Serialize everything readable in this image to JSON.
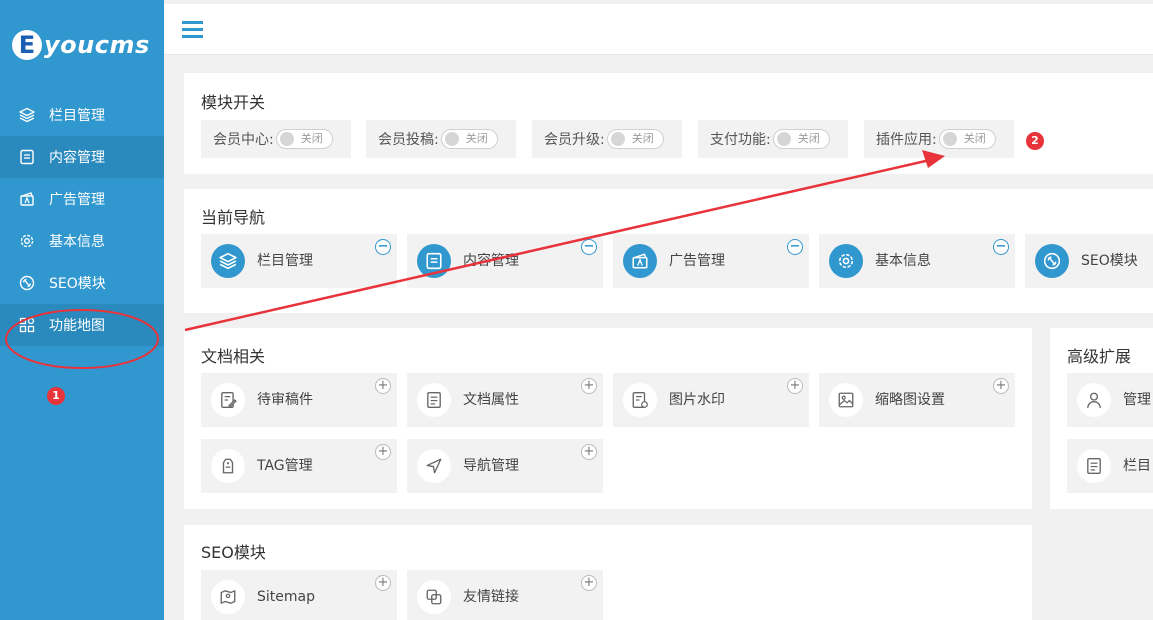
{
  "app": {
    "logo_letter": "E",
    "logo_text": "youcms"
  },
  "sidebar": {
    "items": [
      {
        "label": "栏目管理",
        "icon": "layers-icon"
      },
      {
        "label": "内容管理",
        "icon": "document-icon"
      },
      {
        "label": "广告管理",
        "icon": "ad-icon"
      },
      {
        "label": "基本信息",
        "icon": "gear-icon"
      },
      {
        "label": "SEO模块",
        "icon": "seo-icon"
      },
      {
        "label": "功能地图",
        "icon": "grid-icon"
      }
    ],
    "annotation_badge": "1"
  },
  "module_switch": {
    "title": "模块开关",
    "items": [
      {
        "label": "会员中心:",
        "state": "关闭"
      },
      {
        "label": "会员投稿:",
        "state": "关闭"
      },
      {
        "label": "会员升级:",
        "state": "关闭"
      },
      {
        "label": "支付功能:",
        "state": "关闭"
      },
      {
        "label": "插件应用:",
        "state": "关闭"
      }
    ],
    "annotation_badge": "2"
  },
  "current_nav": {
    "title": "当前导航",
    "items": [
      {
        "label": "栏目管理",
        "icon": "layers-icon"
      },
      {
        "label": "内容管理",
        "icon": "document-icon"
      },
      {
        "label": "广告管理",
        "icon": "ad-icon"
      },
      {
        "label": "基本信息",
        "icon": "gear-icon"
      },
      {
        "label": "SEO模块",
        "icon": "seo-icon"
      }
    ],
    "corner_symbol": "−"
  },
  "docs": {
    "title": "文档相关",
    "items": [
      {
        "label": "待审稿件",
        "icon": "pending-edit-icon"
      },
      {
        "label": "文档属性",
        "icon": "document-icon"
      },
      {
        "label": "图片水印",
        "icon": "watermark-icon"
      },
      {
        "label": "缩略图设置",
        "icon": "image-icon"
      },
      {
        "label": "TAG管理",
        "icon": "tag-icon"
      },
      {
        "label": "导航管理",
        "icon": "navigation-icon"
      }
    ],
    "corner_symbol": "+"
  },
  "advanced": {
    "title": "高级扩展",
    "items": [
      {
        "label": "管理",
        "icon": "user-icon"
      },
      {
        "label": "栏目",
        "icon": "document-icon"
      }
    ]
  },
  "seo": {
    "title": "SEO模块",
    "items": [
      {
        "label": "Sitemap",
        "icon": "sitemap-icon"
      },
      {
        "label": "友情链接",
        "icon": "link-icon"
      }
    ]
  },
  "colors": {
    "sidebar": "#3197cf",
    "accent": "#3197cf",
    "badge": "#e8333a",
    "arrow": "#e8333a"
  }
}
